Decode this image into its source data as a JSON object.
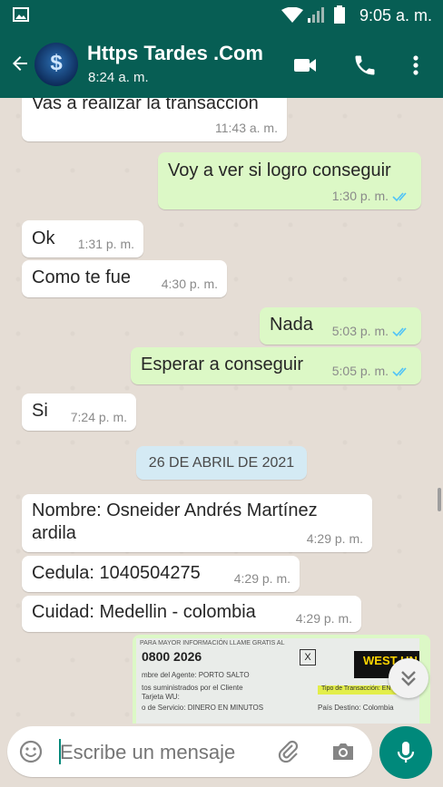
{
  "status": {
    "time": "9:05 a. m."
  },
  "header": {
    "title": "Https Tardes .Com",
    "subtitle": "8:24 a. m.",
    "avatar_symbol": "$"
  },
  "messages": [
    {
      "text": "Vas a realizar la transacción",
      "time": "11:43 a. m."
    },
    {
      "text": "Voy a ver si logro conseguir",
      "time": "1:30 p. m."
    },
    {
      "text": "Ok",
      "time": "1:31 p. m."
    },
    {
      "text": "Como te fue",
      "time": "4:30 p. m."
    },
    {
      "text": "Nada",
      "time": "5:03 p. m."
    },
    {
      "text": "Esperar a conseguir",
      "time": "5:05 p. m."
    },
    {
      "text": "Si",
      "time": "7:24 p. m."
    },
    {
      "text": "Nombre: Osneider Andrés Martínez ardila",
      "time": "4:29 p. m."
    },
    {
      "text": "Cedula: 1040504275",
      "time": "4:29 p. m."
    },
    {
      "text": "Cuidad: Medellin - colombia",
      "time": "4:29 p. m."
    }
  ],
  "date_chip": "26 DE ABRIL DE 2021",
  "image_doc": {
    "header": "PARA MAYOR INFORMACIÓN LLAME GRATIS AL",
    "number": "0800 2026",
    "agent": "mbre del Agente: PORTO SALTO",
    "supplied": "tos suministrados por el Cliente",
    "card": "Tarjeta WU:",
    "service": "o de Servicio:   DINERO EN MINUTOS",
    "transaction_type": "Tipo de Transacción: ENVÍO",
    "brand": "WEST UN",
    "country": "País Destino:   Colombia"
  },
  "input": {
    "placeholder": "Escribe un mensaje"
  },
  "colors": {
    "header": "#075e54",
    "outgoing": "#dcf8c6",
    "incoming": "#ffffff",
    "accent": "#00897b",
    "ticks": "#4fc3f7"
  }
}
